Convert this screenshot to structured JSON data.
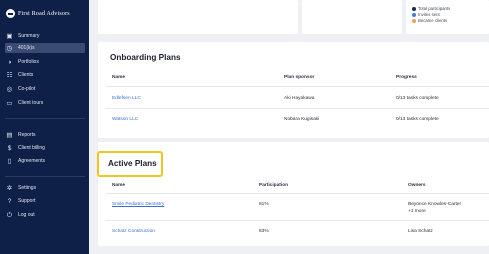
{
  "brand": {
    "name": "First Road Advisors"
  },
  "sidebar": {
    "items": [
      {
        "label": "Summary",
        "icon": "summary-icon",
        "glyph": "▣"
      },
      {
        "label": "401(k)s",
        "icon": "piggybank-icon",
        "glyph": "◷"
      },
      {
        "label": "Portfolios",
        "icon": "portfolio-icon",
        "glyph": "◑"
      },
      {
        "label": "Clients",
        "icon": "people-icon",
        "glyph": "☷"
      },
      {
        "label": "Co-pilot",
        "icon": "compass-icon",
        "glyph": "◎"
      },
      {
        "label": "Client tours",
        "icon": "tours-icon",
        "glyph": "▭"
      },
      {
        "label": "Reports",
        "icon": "reports-icon",
        "glyph": "▤"
      },
      {
        "label": "Client billing",
        "icon": "billing-icon",
        "glyph": "$"
      },
      {
        "label": "Agreements",
        "icon": "document-icon",
        "glyph": "▯"
      },
      {
        "label": "Settings",
        "icon": "gear-icon",
        "glyph": "✲"
      },
      {
        "label": "Support",
        "icon": "help-icon",
        "glyph": "?"
      },
      {
        "label": "Log out",
        "icon": "power-icon",
        "glyph": "⏻"
      }
    ],
    "active_index": 1
  },
  "legend": {
    "items": [
      {
        "label": "Total participants",
        "color": "#1b2a4a"
      },
      {
        "label": "Invites sent",
        "color": "#3d7be0"
      },
      {
        "label": "Became clients",
        "color": "#f0a05a"
      }
    ]
  },
  "onboarding": {
    "title": "Onboarding Plans",
    "headers": {
      "name": "Name",
      "sponsor": "Plan sponsor",
      "progress": "Progress"
    },
    "rows": [
      {
        "name": "Edlefsen LLC",
        "sponsor": "Aki Hayakawa",
        "progress": "0/13 tasks complete"
      },
      {
        "name": "Watson LLC",
        "sponsor": "Nobara Kugisaki",
        "progress": "0/13 tasks complete"
      }
    ]
  },
  "active": {
    "title": "Active Plans",
    "headers": {
      "name": "Name",
      "participation": "Participation",
      "owners": "Owners"
    },
    "rows": [
      {
        "name": "Smile Pediatric Dentistry",
        "participation": "81%",
        "owners": "Beyonce Knowles-Carter",
        "owners_more": "+1 more"
      },
      {
        "name": "Schatz Construction",
        "participation": "83%",
        "owners": "Lisa Schatz",
        "owners_more": ""
      }
    ]
  },
  "colors": {
    "sidebar_bg": "#0e1f48",
    "highlight": "#f3c320",
    "link": "#3a6fd1"
  }
}
